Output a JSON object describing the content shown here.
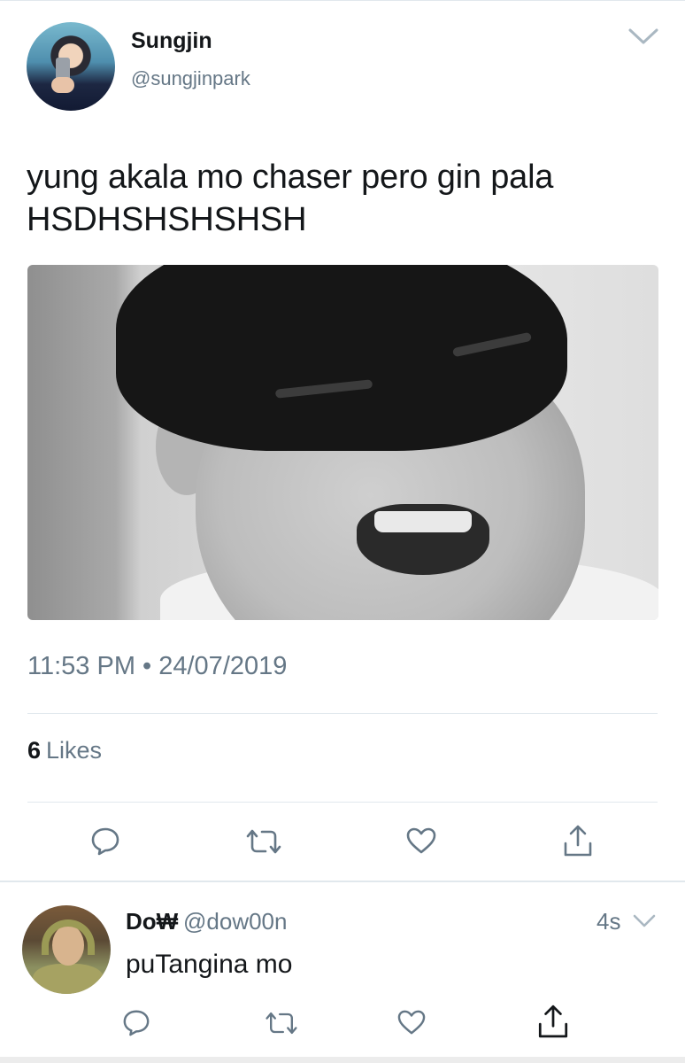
{
  "tweet": {
    "author_name": "Sungjin",
    "author_handle": "@sungjinpark",
    "text": "yung akala mo chaser pero gin pala HSDHSHSHSHSH",
    "timestamp": "11:53 PM • 24/07/2019",
    "likes_count": "6",
    "likes_label": "Likes"
  },
  "reply": {
    "author_name": "Do₩",
    "author_handle": "@dow00n",
    "time": "4s",
    "text": "puTangina mo"
  },
  "icons": {
    "reply": "reply-icon",
    "retweet": "retweet-icon",
    "like": "heart-icon",
    "share": "share-icon",
    "menu": "chevron-down-icon"
  },
  "colors": {
    "primary_text": "#14171a",
    "secondary_text": "#657786",
    "divider": "#e1e8ed"
  }
}
